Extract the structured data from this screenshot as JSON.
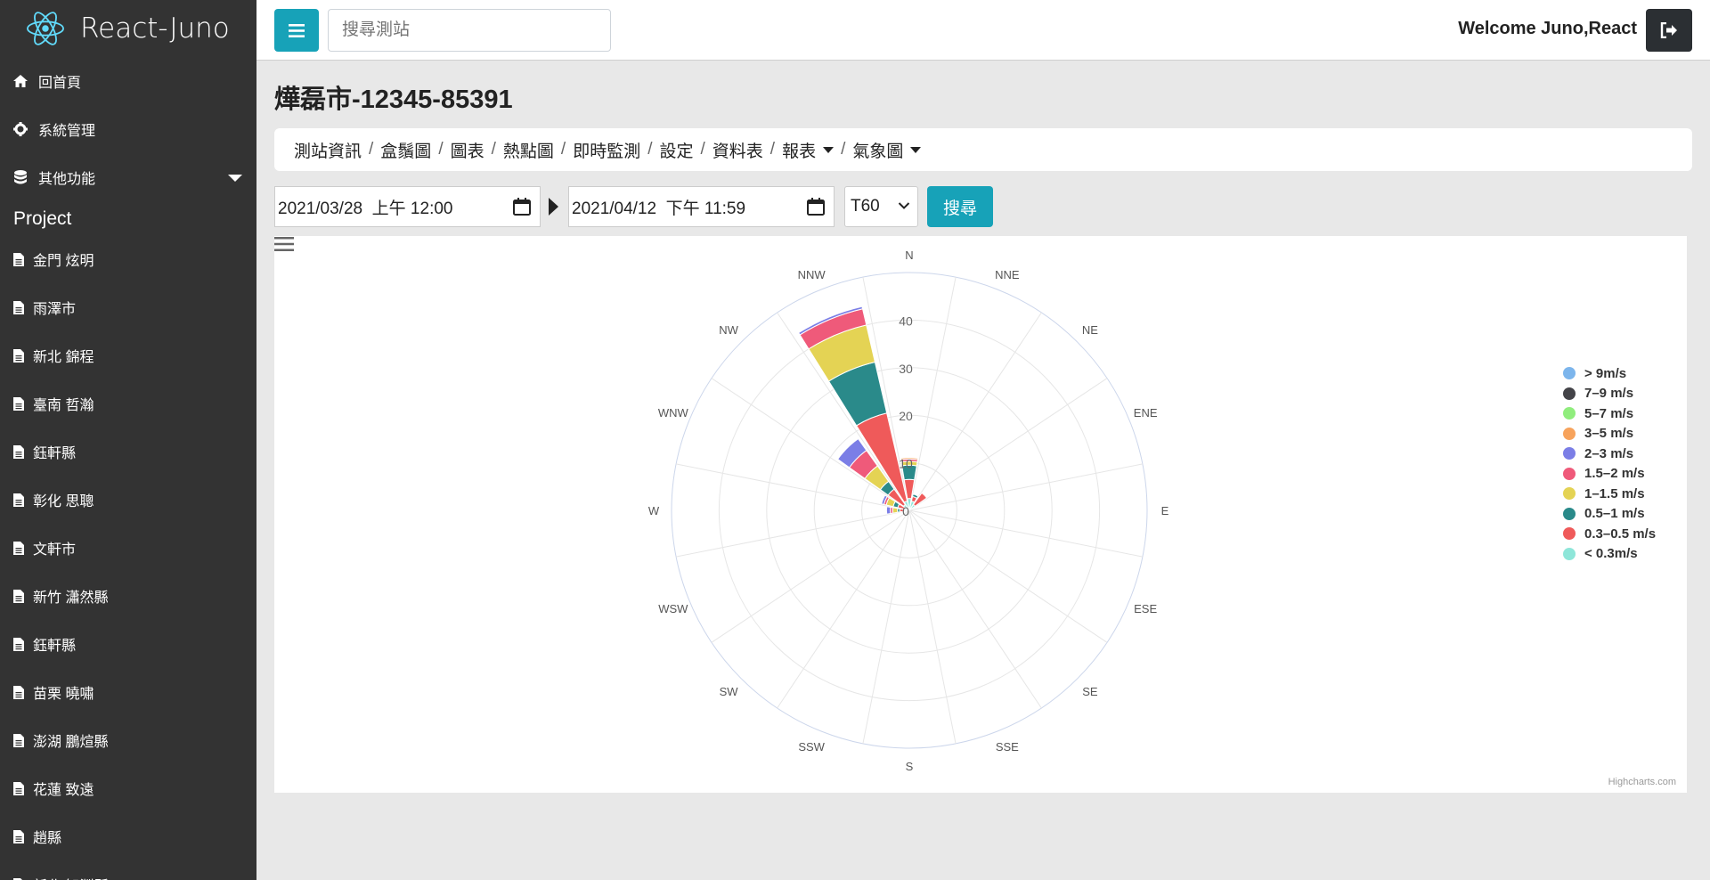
{
  "app": {
    "name": "React-Juno"
  },
  "header": {
    "search_placeholder": "搜尋測站",
    "welcome": "Welcome Juno,React"
  },
  "sidebar": {
    "nav": [
      {
        "label": "回首頁",
        "icon": "home-icon"
      },
      {
        "label": "系統管理",
        "icon": "gear-icon"
      },
      {
        "label": "其他功能",
        "icon": "database-icon"
      }
    ],
    "section": "Project",
    "projects": [
      {
        "label": "金門 炫明"
      },
      {
        "label": "雨澤市"
      },
      {
        "label": "新北 錦程"
      },
      {
        "label": "臺南 哲瀚"
      },
      {
        "label": "鈺軒縣"
      },
      {
        "label": "彰化 思聰"
      },
      {
        "label": "文軒市"
      },
      {
        "label": "新竹 瀟然縣"
      },
      {
        "label": "鈺軒縣"
      },
      {
        "label": "苗栗 曉嘯"
      },
      {
        "label": "澎湖 鵬煊縣"
      },
      {
        "label": "花蓮 致遠"
      },
      {
        "label": "趙縣"
      },
      {
        "label": "新北 智淵縣"
      }
    ]
  },
  "page": {
    "title": "燁磊市-12345-85391"
  },
  "breadcrumb": {
    "items": [
      "測站資訊",
      "盒鬚圖",
      "圖表",
      "熱點圖",
      "即時監測",
      "設定",
      "資料表",
      "報表",
      "氣象圖"
    ],
    "separator": "/"
  },
  "filters": {
    "start": "2021/03/28  上午 12:00",
    "end": "2021/04/12  下午 11:59",
    "interval": "T60",
    "search_label": "搜尋"
  },
  "chart_data": {
    "type": "polar-stacked-column",
    "credits": "Highcharts.com",
    "directions": [
      "N",
      "NNE",
      "NE",
      "ENE",
      "E",
      "ESE",
      "SE",
      "SSE",
      "S",
      "SSW",
      "SW",
      "WSW",
      "W",
      "WNW",
      "NW",
      "NNW"
    ],
    "radial_ticks": [
      0,
      10,
      20,
      30,
      40
    ],
    "ymax": 50,
    "series": [
      {
        "name": "< 0.3m/s",
        "color": "#8ee6d9",
        "values": [
          2.5,
          2,
          1.5,
          0,
          0,
          0,
          0,
          0,
          0,
          0,
          0,
          0,
          1,
          1,
          1.5,
          2
        ]
      },
      {
        "name": "0.3–0.5 m/s",
        "color": "#ef5a5a",
        "values": [
          4,
          1,
          3,
          0,
          0,
          0,
          0,
          0,
          0,
          0,
          0,
          0,
          1,
          1.5,
          4,
          19
        ]
      },
      {
        "name": "0.5–1 m/s",
        "color": "#2a8a8a",
        "values": [
          3,
          0.5,
          0,
          0,
          0,
          0,
          0,
          0,
          0,
          0,
          0,
          0,
          0.5,
          1,
          2,
          11
        ]
      },
      {
        "name": "1–1.5 m/s",
        "color": "#e4d354",
        "values": [
          0.8,
          0,
          0,
          0,
          0,
          0,
          0,
          0,
          0,
          0,
          0,
          0,
          1,
          1.5,
          4,
          8
        ]
      },
      {
        "name": "1.5–2 m/s",
        "color": "#ef5a7a",
        "values": [
          0.5,
          0,
          0,
          0,
          0,
          0,
          0,
          0,
          0,
          0,
          0,
          0,
          0.5,
          0.5,
          4,
          3.5
        ]
      },
      {
        "name": "2–3 m/s",
        "color": "#7b7ee6",
        "values": [
          0,
          0,
          0,
          0,
          0,
          0,
          0,
          0,
          0,
          0,
          0,
          0,
          0.8,
          0.5,
          3,
          0.5
        ]
      },
      {
        "name": "3–5 m/s",
        "color": "#f7a35c",
        "values": [
          0.3,
          0,
          0,
          0,
          0,
          0,
          0,
          0,
          0,
          0,
          0,
          0,
          0,
          0,
          0,
          0
        ]
      },
      {
        "name": "5–7 m/s",
        "color": "#90ed7d",
        "values": [
          0,
          0,
          0,
          0,
          0,
          0,
          0,
          0,
          0,
          0,
          0,
          0,
          0,
          0,
          0,
          0
        ]
      },
      {
        "name": "7–9 m/s",
        "color": "#434348",
        "values": [
          0,
          0,
          0,
          0,
          0,
          0,
          0,
          0,
          0,
          0,
          0,
          0,
          0,
          0,
          0,
          0
        ]
      },
      {
        "name": "> 9m/s",
        "color": "#7cb5ec",
        "values": [
          0,
          0,
          0,
          0,
          0,
          0,
          0,
          0,
          0,
          0,
          0,
          0,
          0,
          0,
          0,
          0
        ]
      }
    ],
    "legend_order": [
      "> 9m/s",
      "7–9 m/s",
      "5–7 m/s",
      "3–5 m/s",
      "2–3 m/s",
      "1.5–2 m/s",
      "1–1.5 m/s",
      "0.5–1 m/s",
      "0.3–0.5 m/s",
      "< 0.3m/s"
    ],
    "legend_position": "right"
  }
}
